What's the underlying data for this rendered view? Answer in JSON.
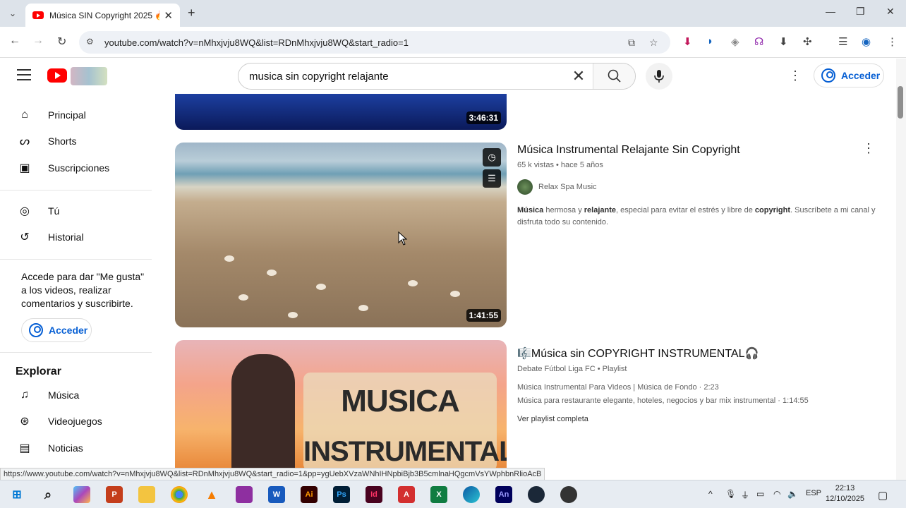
{
  "browser": {
    "tab_title": "Música SIN Copyright 2025 🔥",
    "url": "youtube.com/watch?v=nMhxjvju8WQ&list=RDnMhxjvju8WQ&start_radio=1",
    "status_url": "https://www.youtube.com/watch?v=nMhxjvju8WQ&list=RDnMhxjvju8WQ&start_radio=1&pp=ygUebXVzaWNhIHNpbiBjb3B5cmlnaHQgcmVsYWphbnRlioAcB"
  },
  "header": {
    "search_value": "musica sin copyright relajante",
    "signin_label": "Acceder"
  },
  "sidebar": {
    "items": [
      {
        "label": "Principal"
      },
      {
        "label": "Shorts"
      },
      {
        "label": "Suscripciones"
      },
      {
        "label": "Tú"
      },
      {
        "label": "Historial"
      }
    ],
    "signin_message": "Accede para dar \"Me gusta\" a los videos, realizar comentarios y suscribirte.",
    "signin_label": "Acceder",
    "explore_title": "Explorar",
    "explore_items": [
      {
        "label": "Música"
      },
      {
        "label": "Videojuegos"
      },
      {
        "label": "Noticias"
      }
    ]
  },
  "results": [
    {
      "duration": "3:46:31"
    },
    {
      "title": "Música Instrumental Relajante Sin Copyright",
      "meta": "65 k vistas • hace 5 años",
      "channel": "Relax Spa Music",
      "duration": "1:41:55",
      "desc_parts": [
        "Música",
        " hermosa y ",
        "relajante",
        ", especial para evitar el estrés y libre de ",
        "copyright",
        ". Suscríbete a mi canal y disfruta todo su contenido."
      ]
    },
    {
      "title": "🎼Música sin COPYRIGHT INSTRUMENTAL🎧",
      "meta": "Debate Fútbol Liga FC • Playlist",
      "line1": "Música Instrumental Para Videos | Música de Fondo · 2:23",
      "line2": "Música para restaurante elegante, hoteles, negocios y bar mix instrumental · 1:14:55",
      "link": "Ver playlist completa",
      "thumb_text_1": "MUSICA",
      "thumb_text_2": "INSTRUMENTAL"
    }
  ],
  "taskbar": {
    "lang": "ESP",
    "time": "22:13",
    "date": "12/10/2025"
  }
}
